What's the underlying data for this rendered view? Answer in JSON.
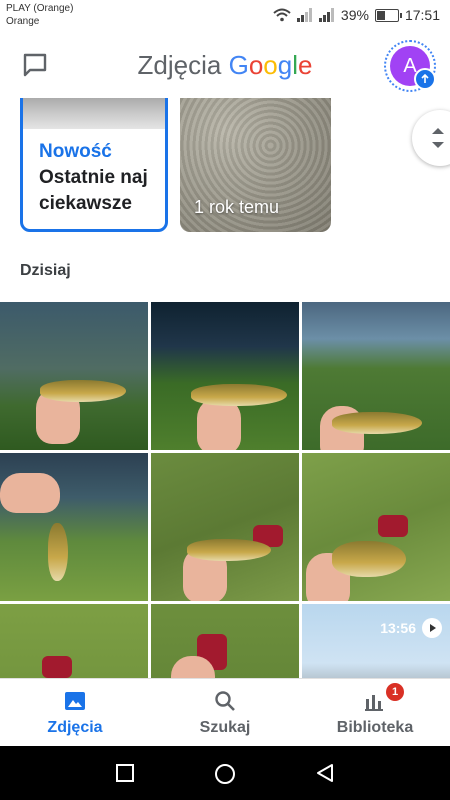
{
  "status_bar": {
    "carrier_line1": "PLAY (Orange)",
    "carrier_line2": "Orange",
    "battery_percent": "39%",
    "battery_level": 0.39,
    "time": "17:51"
  },
  "app_bar": {
    "title_prefix": "Zdjęcia",
    "title_brand": [
      "G",
      "o",
      "o",
      "g",
      "l",
      "e"
    ],
    "brand_colors": [
      "#4285f4",
      "#ea4335",
      "#fbbc05",
      "#4285f4",
      "#34a853",
      "#ea4335"
    ],
    "avatar_letter": "A",
    "avatar_color": "#a142f4"
  },
  "memories": {
    "new_label": "Nowość",
    "new_desc": "Ostatnie naj ciekawsze",
    "year_label": "1 rok temu"
  },
  "section": {
    "label": "Dzisiaj"
  },
  "video": {
    "duration": "13:56"
  },
  "bottom_nav": {
    "items": [
      {
        "label": "Zdjęcia",
        "icon": "photo-icon",
        "active": true
      },
      {
        "label": "Szukaj",
        "icon": "search-icon",
        "active": false
      },
      {
        "label": "Biblioteka",
        "icon": "library-icon",
        "active": false,
        "badge": "1"
      }
    ]
  },
  "colors": {
    "accent": "#1a73e8",
    "badge": "#d93025"
  }
}
